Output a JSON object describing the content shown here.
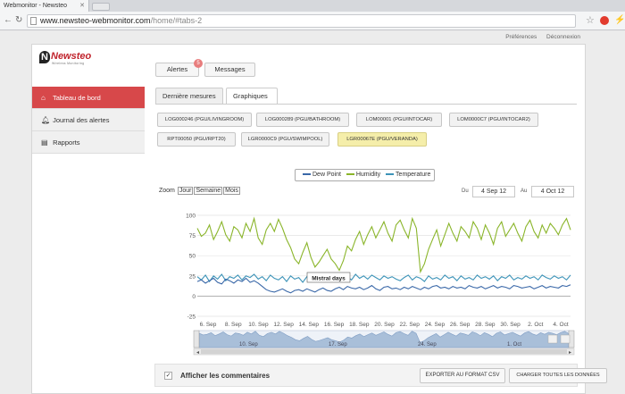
{
  "browser": {
    "tab_title": "Webmonitor - Newsteo",
    "url_host": "www.newsteo-webmonitor.com",
    "url_path": "/home/#tabs-2"
  },
  "header": {
    "logo_name": "Newsteo",
    "logo_tagline": "Wireless Monitoring",
    "links": [
      "Préférences",
      "Déconnexion"
    ]
  },
  "sidebar": {
    "items": [
      {
        "label": "Tableau de bord",
        "icon": "home-icon"
      },
      {
        "label": "Journal des alertes",
        "icon": "bell-icon"
      },
      {
        "label": "Rapports",
        "icon": "report-icon"
      }
    ]
  },
  "top_buttons": {
    "alertes_label": "Alertes",
    "alertes_badge": "5",
    "messages_label": "Messages"
  },
  "tabs": [
    "Dernière mesures",
    "Graphiques"
  ],
  "loggers": [
    "LOG000246 (PGU/LIVINGROOM)",
    "LOG000289 (PGU/BATHROOM)",
    "LOM00001 (PGU/INTOCAR)",
    "LOM0000C7 (PGU/INTOCAR2)",
    "RPT00050 (PGU/RPT20)",
    "LGR0000C9 (PGU/SWIMPOOL)",
    "LGR00067E (PGU/VERANDA)"
  ],
  "selected_logger_index": 6,
  "zoom": {
    "label": "Zoom",
    "buttons": [
      "Jour",
      "Semaine",
      "Mois"
    ]
  },
  "date_range": {
    "from_label": "Du",
    "from": "4 Sep 12",
    "to_label": "Au",
    "to": "4 Oct 12"
  },
  "chart_data": {
    "type": "line",
    "series": [
      {
        "name": "Dew Point",
        "color": "#3a68a8"
      },
      {
        "name": "Humidity",
        "color": "#8ab52a"
      },
      {
        "name": "Temperature",
        "color": "#3c93b8"
      }
    ],
    "y_ticks": [
      "100",
      "75",
      "50",
      "25",
      "0",
      "-25"
    ],
    "ylim": [
      -25,
      100
    ],
    "x_ticks": [
      "6. Sep",
      "8. Sep",
      "10. Sep",
      "12. Sep",
      "14. Sep",
      "16. Sep",
      "18. Sep",
      "20. Sep",
      "22. Sep",
      "24. Sep",
      "26. Sep",
      "28. Sep",
      "30. Sep",
      "2. Oct",
      "4. Oct"
    ],
    "annotation": "Mistral days",
    "navigator_ticks": [
      "10. Sep",
      "17. Sep",
      "24. Sep",
      "1. Oct"
    ],
    "humidity": [
      84,
      74,
      78,
      88,
      70,
      80,
      92,
      76,
      68,
      86,
      82,
      72,
      90,
      80,
      96,
      72,
      64,
      82,
      90,
      80,
      95,
      84,
      70,
      60,
      46,
      40,
      54,
      66,
      48,
      36,
      42,
      50,
      58,
      46,
      40,
      32,
      44,
      62,
      56,
      70,
      80,
      64,
      76,
      86,
      72,
      82,
      92,
      78,
      68,
      88,
      94,
      82,
      72,
      96,
      84,
      30,
      40,
      58,
      70,
      82,
      62,
      76,
      90,
      78,
      68,
      86,
      80,
      72,
      92,
      84,
      70,
      88,
      78,
      64,
      84,
      92,
      74,
      82,
      90,
      78,
      68,
      86,
      94,
      80,
      72,
      88,
      78,
      90,
      84,
      76,
      88,
      96,
      82
    ],
    "dewpoint": [
      18,
      20,
      16,
      19,
      22,
      17,
      15,
      21,
      19,
      16,
      20,
      18,
      22,
      17,
      19,
      16,
      12,
      8,
      6,
      5,
      7,
      9,
      6,
      4,
      7,
      8,
      6,
      9,
      7,
      5,
      8,
      10,
      7,
      6,
      9,
      11,
      8,
      12,
      10,
      9,
      11,
      8,
      10,
      13,
      9,
      7,
      11,
      12,
      9,
      10,
      8,
      11,
      9,
      12,
      10,
      8,
      11,
      9,
      12,
      13,
      10,
      11,
      9,
      12,
      10,
      11,
      9,
      13,
      11,
      10,
      12,
      9,
      11,
      13,
      10,
      12,
      11,
      9,
      13,
      12,
      10,
      11,
      12,
      9,
      11,
      13,
      10,
      12,
      11,
      10,
      13,
      12,
      14
    ],
    "temperature": [
      24,
      20,
      26,
      18,
      25,
      21,
      27,
      19,
      24,
      22,
      26,
      20,
      25,
      23,
      27,
      21,
      24,
      19,
      26,
      22,
      20,
      24,
      18,
      25,
      21,
      23,
      17,
      24,
      20,
      22,
      18,
      25,
      21,
      23,
      19,
      26,
      22,
      24,
      20,
      27,
      22,
      25,
      21,
      26,
      23,
      20,
      25,
      22,
      24,
      21,
      19,
      23,
      26,
      20,
      24,
      22,
      18,
      25,
      21,
      23,
      20,
      26,
      22,
      24,
      19,
      25,
      21,
      23,
      20,
      26,
      22,
      24,
      21,
      25,
      19,
      24,
      22,
      26,
      20,
      23,
      21,
      25,
      22,
      24,
      20,
      26,
      23,
      21,
      25,
      22,
      24,
      20,
      26
    ]
  },
  "bottom": {
    "comments_label": "Afficher les commentaires",
    "export_label": "EXPORTER AU FORMAT CSV",
    "load_all_label": "CHARGER TOUTES LES DONNÉES"
  }
}
